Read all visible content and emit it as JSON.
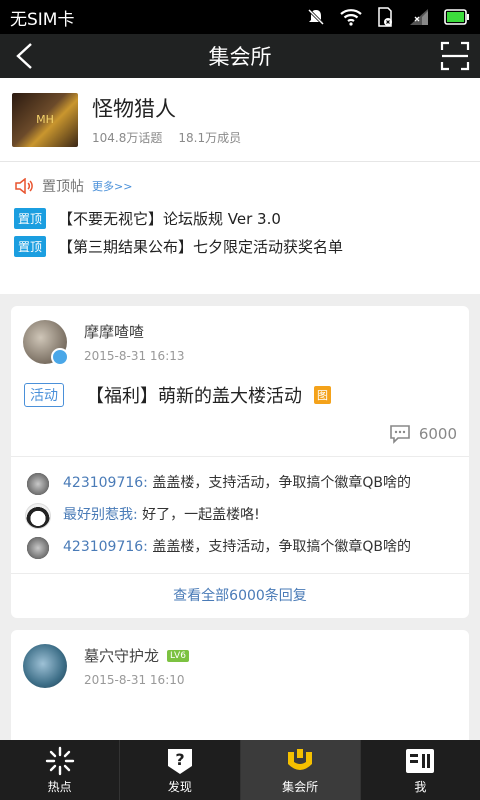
{
  "status_bar": {
    "carrier": "无SIM卡"
  },
  "header": {
    "title": "集会所"
  },
  "group": {
    "name": "怪物猎人",
    "topics": "104.8万话题",
    "members": "18.1万成员"
  },
  "pinned": {
    "label": "置顶帖",
    "more": "更多>>",
    "items": [
      {
        "badge": "置顶",
        "title": "【不要无视它】论坛版规 Ver 3.0"
      },
      {
        "badge": "置顶",
        "title": "【第三期结果公布】七夕限定活动获奖名单"
      }
    ]
  },
  "posts": [
    {
      "author": "摩摩喳喳",
      "time": "2015-8-31 16:13",
      "tag": "活动",
      "title": "【福利】萌新的盖大楼活动",
      "image_tag": "图",
      "comments": "6000",
      "replies": [
        {
          "user": "423109716:",
          "text": "盖盖楼，支持活动，争取搞个徽章QB啥的"
        },
        {
          "user": "最好别惹我:",
          "text": "好了，一起盖楼咯!"
        },
        {
          "user": "423109716:",
          "text": "盖盖楼，支持活动，争取搞个徽章QB啥的"
        }
      ],
      "view_all": "查看全部6000条回复"
    },
    {
      "author": "墓穴守护龙",
      "level": "LV6",
      "time": "2015-8-31 16:10"
    }
  ],
  "tabs": [
    {
      "label": "热点",
      "icon": "burst-icon"
    },
    {
      "label": "发现",
      "icon": "question-icon"
    },
    {
      "label": "集会所",
      "icon": "crown-icon",
      "active": true
    },
    {
      "label": "我",
      "icon": "profile-icon"
    }
  ],
  "colors": {
    "accent_blue": "#1b9ee0",
    "link_blue": "#4a7bb7",
    "active_tab_icon": "#f5c000",
    "image_tag": "#f4a21a",
    "level_badge": "#7cc241"
  }
}
